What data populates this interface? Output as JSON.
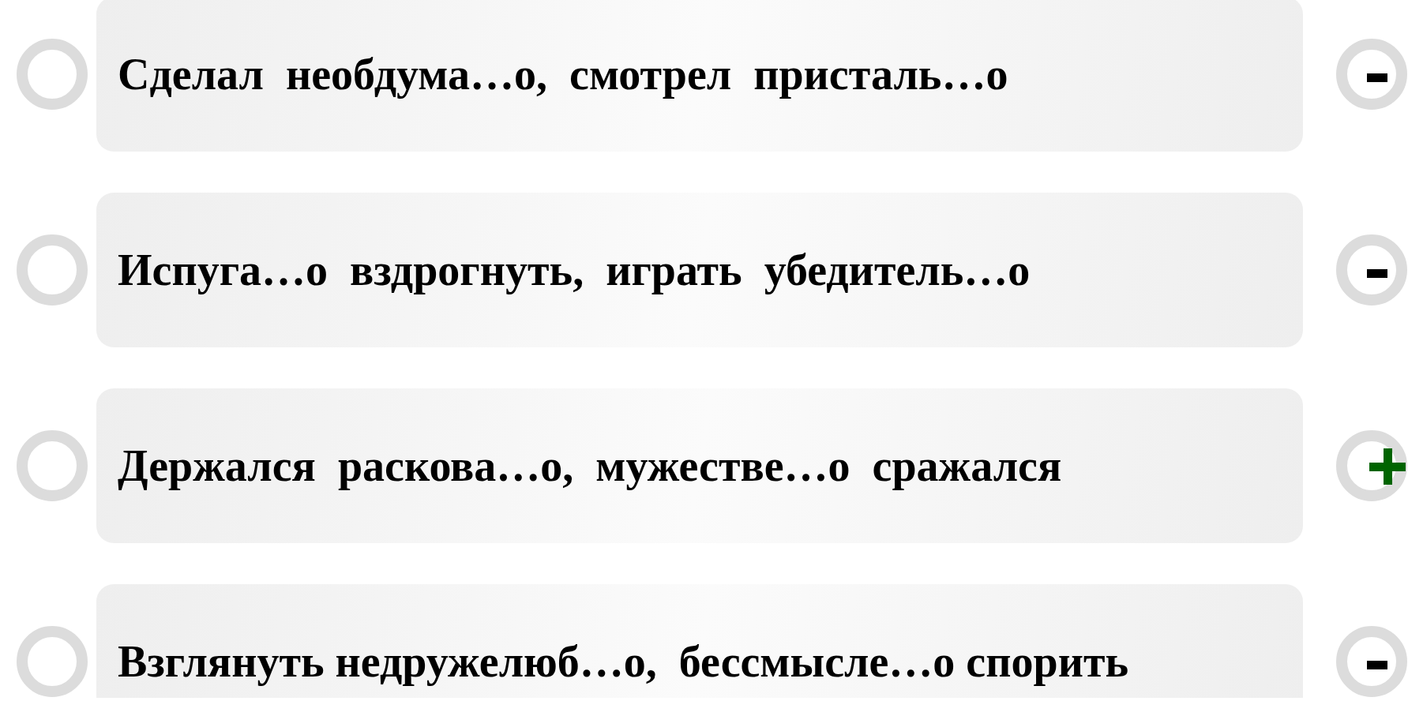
{
  "answers": [
    {
      "text": "Сделал  необдума…о,  смотрел  присталь…о",
      "selected": false,
      "kind": "minus"
    },
    {
      "text": "Испуга…о  вздрогнуть,  играть  убедитель…о",
      "selected": false,
      "kind": "minus"
    },
    {
      "text": "Держался  раскова…о,  мужестве…о  сражался",
      "selected": false,
      "kind": "plus"
    },
    {
      "text": "Взглянуть недружелюб…о,  бессмысле…о спорить",
      "selected": false,
      "kind": "minus"
    }
  ]
}
